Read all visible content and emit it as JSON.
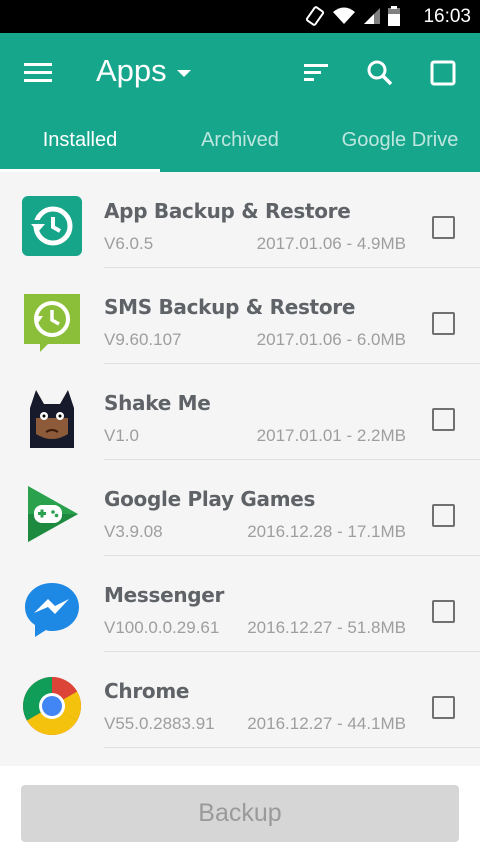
{
  "status_bar": {
    "time": "16:03"
  },
  "app_bar": {
    "title": "Apps",
    "icons": [
      "menu-icon",
      "sort-icon",
      "search-icon",
      "select-all-checkbox-icon"
    ],
    "accent_color": "#16a68c"
  },
  "tabs": [
    {
      "label": "Installed",
      "active": true
    },
    {
      "label": "Archived",
      "active": false
    },
    {
      "label": "Google Drive",
      "active": false
    }
  ],
  "apps": [
    {
      "name": "App Backup & Restore",
      "version": "V6.0.5",
      "meta": "2017.01.06 - 4.9MB",
      "icon": "app-backup-restore-icon"
    },
    {
      "name": "SMS Backup & Restore",
      "version": "V9.60.107",
      "meta": "2017.01.06 - 6.0MB",
      "icon": "sms-backup-restore-icon"
    },
    {
      "name": "Shake Me",
      "version": "V1.0",
      "meta": "2017.01.01 - 2.2MB",
      "icon": "shake-me-icon"
    },
    {
      "name": "Google Play Games",
      "version": "V3.9.08",
      "meta": "2016.12.28 - 17.1MB",
      "icon": "google-play-games-icon"
    },
    {
      "name": "Messenger",
      "version": "V100.0.0.29.61",
      "meta": "2016.12.27 - 51.8MB",
      "icon": "messenger-icon"
    },
    {
      "name": "Chrome",
      "version": "V55.0.2883.91",
      "meta": "2016.12.27 - 44.1MB",
      "icon": "chrome-icon"
    }
  ],
  "footer": {
    "backup_label": "Backup"
  }
}
